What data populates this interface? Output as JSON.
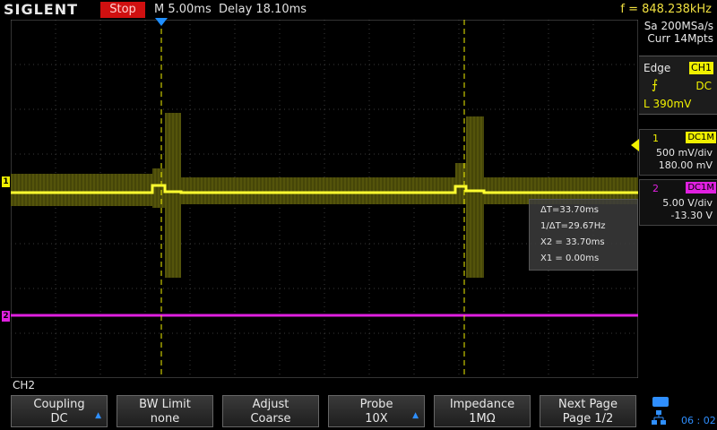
{
  "header": {
    "brand": "SIGLENT",
    "run_state": "Stop",
    "timebase": "M 5.00ms",
    "delay": "Delay 18.10ms",
    "frequency": "f = 848.238kHz"
  },
  "acquisition": {
    "sample_rate": "Sa 200MSa/s",
    "memory_depth": "Curr 14Mpts"
  },
  "trigger": {
    "type": "Edge",
    "source": "CH1",
    "coupling": "DC",
    "level": "L  390mV"
  },
  "channels": [
    {
      "number": "1",
      "coupling": "DC1M",
      "scale": "500 mV/div",
      "offset": "180.00 mV",
      "color": "#f0f000"
    },
    {
      "number": "2",
      "coupling": "DC1M",
      "scale": "5.00 V/div",
      "offset": "-13.30 V",
      "color": "#e020e0"
    }
  ],
  "channel_markers": {
    "ch1": "1",
    "ch2": "2"
  },
  "cursors": {
    "delta_t": "ΔT=33.70ms",
    "inv_delta_t": "1/ΔT=29.67Hz",
    "x2": "X2 = 33.70ms",
    "x1": "X1 = 0.00ms"
  },
  "menu": {
    "title": "CH2",
    "softkeys": [
      {
        "label": "Coupling",
        "value": "DC",
        "has_arrow": true
      },
      {
        "label": "BW Limit",
        "value": "none",
        "has_arrow": false
      },
      {
        "label": "Adjust",
        "value": "Coarse",
        "has_arrow": false
      },
      {
        "label": "Probe",
        "value": "10X",
        "has_arrow": true
      },
      {
        "label": "Impedance",
        "value": "1MΩ",
        "has_arrow": false
      },
      {
        "label": "Next Page",
        "value": "Page 1/2",
        "has_arrow": false
      }
    ]
  },
  "status": {
    "time": "06 : 02",
    "icons": [
      "usb-icon",
      "network-icon"
    ]
  },
  "colors": {
    "ch1": "#f0f000",
    "ch2": "#e020e0",
    "stop": "#d01010",
    "accent": "#2f8fff"
  }
}
